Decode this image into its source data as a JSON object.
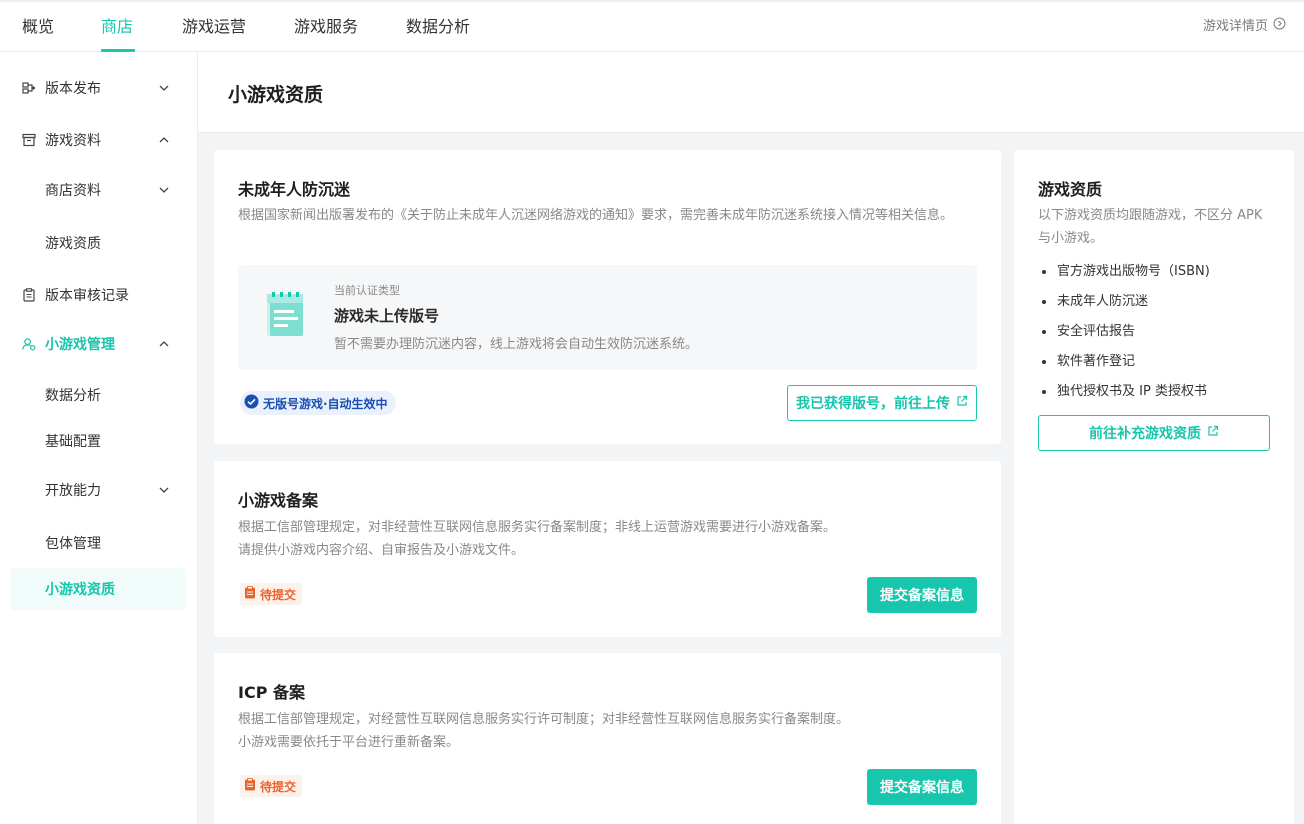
{
  "topnav": {
    "tabs": [
      {
        "label": "概览"
      },
      {
        "label": "商店"
      },
      {
        "label": "游戏运营"
      },
      {
        "label": "游戏服务"
      },
      {
        "label": "数据分析"
      }
    ],
    "active_tab": "商店",
    "detail_link": "游戏详情页"
  },
  "sidebar": {
    "items": [
      {
        "label": "版本发布",
        "icon": "version-release-icon",
        "chevron": "down"
      },
      {
        "label": "游戏资料",
        "icon": "archive-box-icon",
        "chevron": "up"
      },
      {
        "label": "商店资料",
        "chevron": "down"
      },
      {
        "label": "游戏资质"
      },
      {
        "label": "版本审核记录",
        "icon": "clipboard-icon"
      },
      {
        "label": "小游戏管理",
        "icon": "user-circle-icon",
        "chevron": "up"
      },
      {
        "label": "数据分析"
      },
      {
        "label": "基础配置"
      },
      {
        "label": "开放能力",
        "chevron": "down"
      },
      {
        "label": "包体管理"
      },
      {
        "label": "小游戏资质"
      }
    ]
  },
  "page": {
    "title": "小游戏资质"
  },
  "anti_addiction": {
    "title": "未成年人防沉迷",
    "desc": "根据国家新闻出版署发布的《关于防止未成年人沉迷网络游戏的通知》要求，需完善未成年防沉迷系统接入情况等相关信息。",
    "current_type_label": "当前认证类型",
    "current_type_value": "游戏未上传版号",
    "current_type_desc": "暂不需要办理防沉迷内容，线上游戏将会自动生效防沉迷系统。",
    "badge": "无版号游戏·自动生效中",
    "button": "我已获得版号，前往上传"
  },
  "mini_filing": {
    "title": "小游戏备案",
    "desc_line1": "根据工信部管理规定，对非经营性互联网信息服务实行备案制度；非线上运营游戏需要进行小游戏备案。",
    "desc_line2": "请提供小游戏内容介绍、自审报告及小游戏文件。",
    "status": "待提交",
    "button": "提交备案信息"
  },
  "icp_filing": {
    "title": "ICP 备案",
    "desc_line1": "根据工信部管理规定，对经营性互联网信息服务实行许可制度；对非经营性互联网信息服务实行备案制度。",
    "desc_line2": "小游戏需要依托于平台进行重新备案。",
    "status": "待提交",
    "button": "提交备案信息"
  },
  "right_panel": {
    "title": "游戏资质",
    "desc": "以下游戏资质均跟随游戏，不区分 APK 与小游戏。",
    "items": [
      "官方游戏出版物号（ISBN)",
      "未成年人防沉迷",
      "安全评估报告",
      "软件著作登记",
      "独代授权书及 IP 类授权书"
    ],
    "button": "前往补充游戏资质"
  },
  "colors": {
    "accent": "#18c5ad",
    "badge_blue": "#1a4fb4",
    "badge_orange": "#e8652d"
  }
}
